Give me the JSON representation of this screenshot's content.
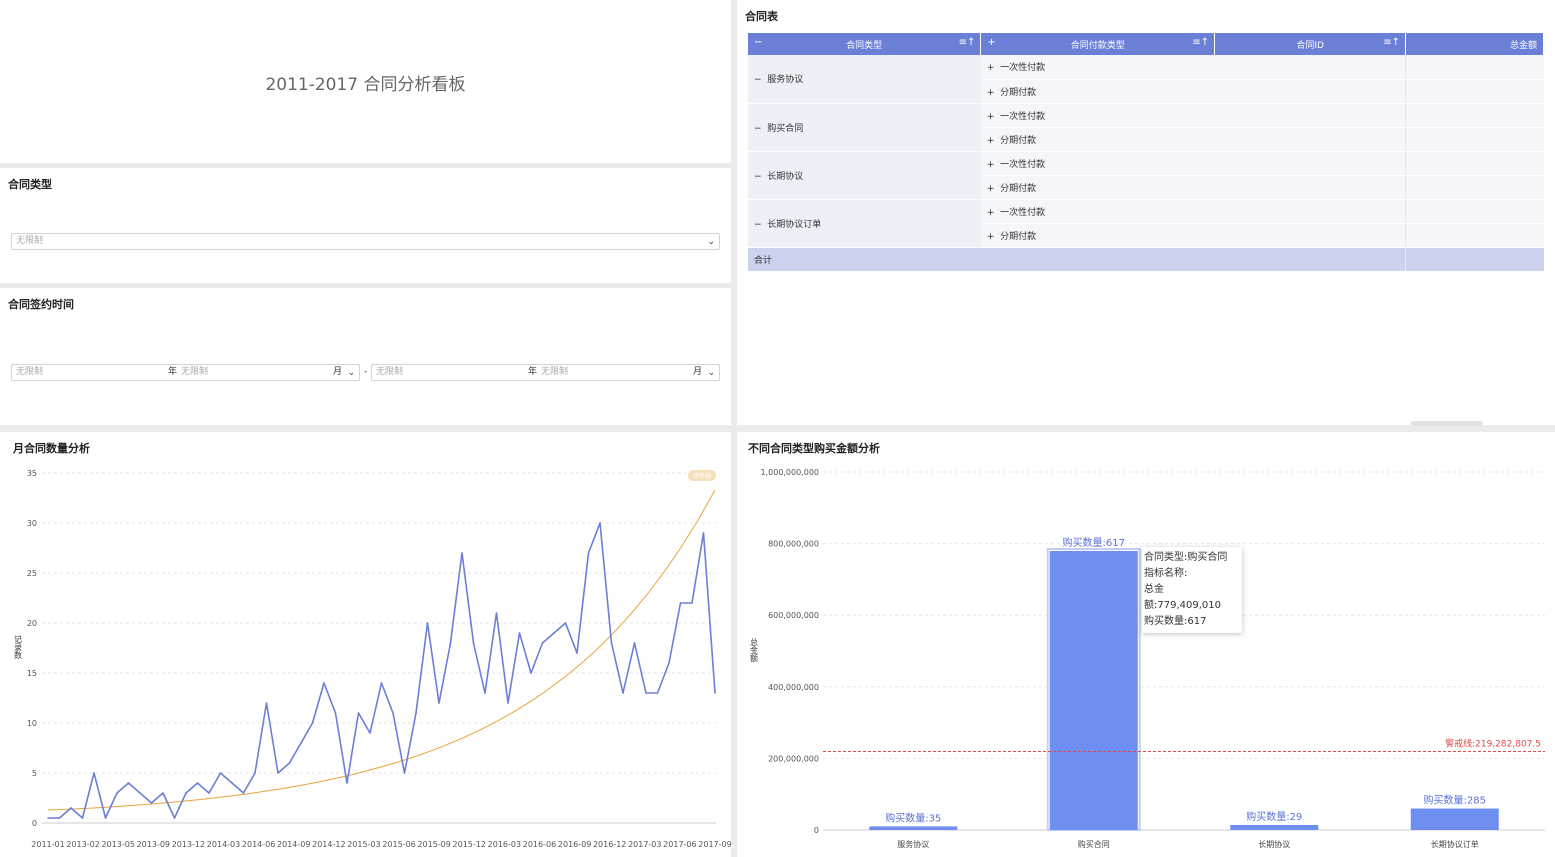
{
  "header": {
    "title": "2011-2017 合同分析看板"
  },
  "filter_type": {
    "title": "合同类型",
    "placeholder": "无限制"
  },
  "filter_time": {
    "title": "合同签约时间",
    "start_year": "无限制",
    "start_month": "无限制",
    "end_year": "无限制",
    "end_month": "无限制",
    "year_unit": "年",
    "month_unit": "月",
    "separator": "-"
  },
  "table": {
    "title": "合同表",
    "headers": [
      "合同类型",
      "合同付款类型",
      "合同ID",
      "总金额"
    ],
    "rows": [
      {
        "type": "服务协议",
        "payments": [
          "一次性付款",
          "分期付款"
        ]
      },
      {
        "type": "购买合同",
        "payments": [
          "一次性付款",
          "分期付款"
        ]
      },
      {
        "type": "长期协议",
        "payments": [
          "一次性付款",
          "分期付款"
        ]
      },
      {
        "type": "长期协议订单",
        "payments": [
          "一次性付款",
          "分期付款"
        ]
      }
    ],
    "total_label": "合计",
    "collapse_symbol": "−",
    "expand_symbol": "+"
  },
  "chart_data": [
    {
      "type": "line",
      "title": "月合同数量分析",
      "ylabel": "记录数",
      "ylim": [
        0,
        35
      ],
      "yticks": [
        0,
        5,
        10,
        15,
        20,
        25,
        30,
        35
      ],
      "xtick_labels": [
        "2011-01",
        "2013-02",
        "2013-05",
        "2013-09",
        "2013-12",
        "2014-03",
        "2014-06",
        "2014-09",
        "2014-12",
        "2015-03",
        "2015-06",
        "2015-09",
        "2015-12",
        "2016-03",
        "2016-06",
        "2016-09",
        "2016-12",
        "2017-03",
        "2017-06",
        "2017-09"
      ],
      "series": [
        {
          "values": [
            0.5,
            0.5,
            1.5,
            0.5,
            5,
            0.5,
            3,
            4,
            3,
            2,
            3,
            0.5,
            3,
            4,
            3,
            5,
            4,
            3,
            5,
            12,
            5,
            6,
            8,
            10,
            14,
            11,
            4,
            11,
            9,
            14,
            11,
            5,
            11,
            20,
            12,
            18,
            27,
            18,
            13,
            21,
            12,
            19,
            15,
            18,
            19,
            20,
            17,
            27,
            30,
            18,
            13,
            18,
            13,
            13,
            16,
            22,
            22,
            29,
            13
          ],
          "color": "#6b7fd7"
        }
      ],
      "trend_line": {
        "label": "趋势线",
        "color": "#e8a33d",
        "start": 1.3,
        "end": 33.3
      }
    },
    {
      "type": "bar",
      "title": "不同合同类型购买金额分析",
      "ylabel": "总金额",
      "ylim": [
        0,
        1000000000
      ],
      "yticks": [
        "0",
        "200,000,000",
        "400,000,000",
        "600,000,000",
        "800,000,000",
        "1,000,000,000"
      ],
      "categories": [
        "服务协议",
        "购买合同",
        "长期协议",
        "长期协议订单"
      ],
      "values": [
        10000000,
        779409010,
        14000000,
        60000000
      ],
      "bar_labels": [
        "购买数量:35",
        "购买数量:617",
        "购买数量:29",
        "购买数量:285"
      ],
      "warning_line": {
        "label": "警戒线:219,282,807.5",
        "value": 219282807.5,
        "color": "#e24b4b"
      },
      "color": "#6f8ff0",
      "tooltip": [
        "合同类型:购买合同",
        "指标名称:",
        "总金额:779,409,010",
        "购买数量:617"
      ]
    }
  ]
}
